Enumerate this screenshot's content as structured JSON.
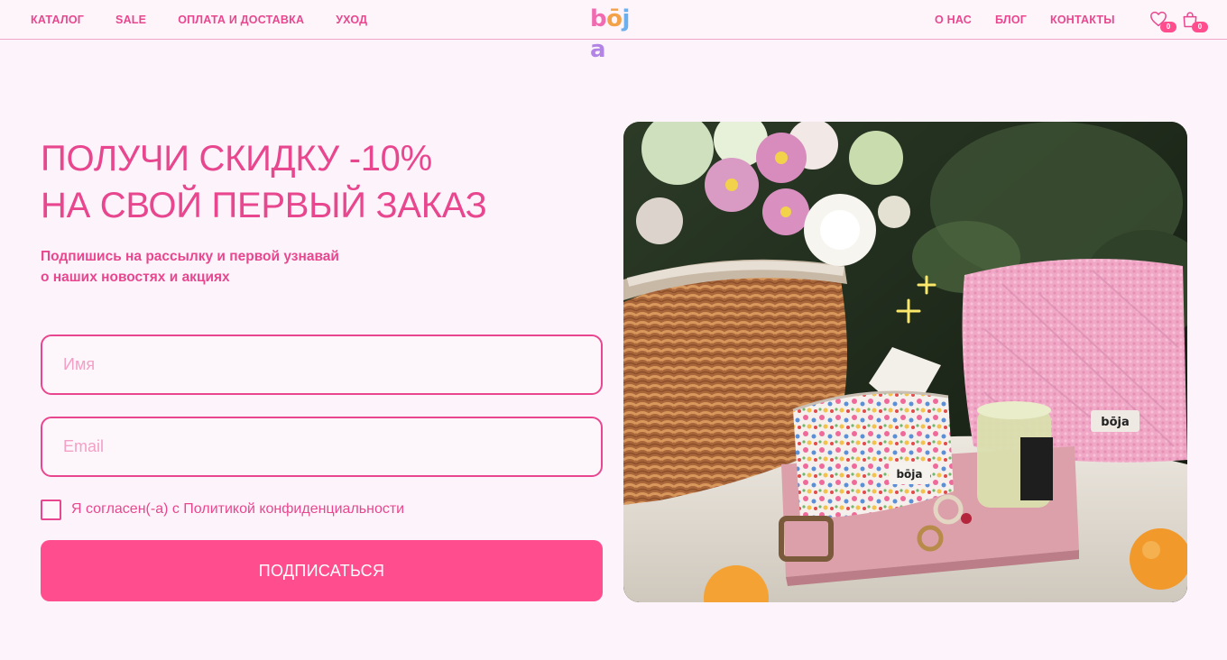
{
  "header": {
    "nav_left": [
      "КАТАЛОГ",
      "SALE",
      "ОПЛАТА И ДОСТАВКА",
      "УХОД"
    ],
    "logo": "bōja",
    "nav_right": [
      "О НАС",
      "БЛОГ",
      "КОНТАКТЫ"
    ],
    "favorites_count": "0",
    "cart_count": "0"
  },
  "promo": {
    "headline_line1": "ПОЛУЧИ СКИДКУ -10%",
    "headline_line2": "НА СВОЙ ПЕРВЫЙ ЗАКАЗ",
    "subtext_line1": "Подпишись на рассылку и первой узнавай",
    "subtext_line2": "о наших новостях и акциях"
  },
  "form": {
    "name_placeholder": "Имя",
    "name_value": "",
    "email_placeholder": "Email",
    "email_value": "",
    "consent_label": "Я согласен(-а) с Политикой конфиденциальности",
    "consent_checked": false,
    "submit_label": "ПОДПИСАТЬСЯ"
  },
  "photo": {
    "bag_brand": "bōja",
    "pouch_brand": "bōja"
  },
  "colors": {
    "accent": "#e8478f",
    "button": "#ff4d8d",
    "background": "#fcf4fa"
  }
}
